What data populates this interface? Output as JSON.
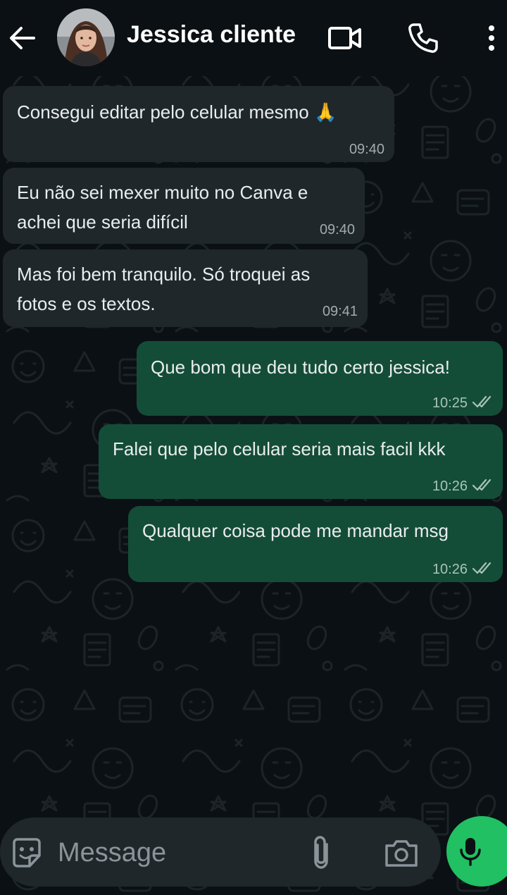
{
  "header": {
    "contact_name": "Jessica cliente",
    "back_icon": "arrow-left-icon",
    "video_icon": "video-camera-icon",
    "call_icon": "phone-icon",
    "menu_icon": "more-vertical-icon"
  },
  "messages": [
    {
      "direction": "in",
      "lines": [
        "Consegui editar pelo celular mesmo 🙏"
      ],
      "time": "09:40"
    },
    {
      "direction": "in",
      "lines": [
        "Eu não sei mexer muito no Canva e",
        "achei que seria difícil"
      ],
      "time": "09:40"
    },
    {
      "direction": "in",
      "lines": [
        "Mas foi bem tranquilo. Só troquei as",
        "fotos e os textos."
      ],
      "time": "09:41"
    },
    {
      "direction": "out",
      "lines": [
        "Que bom que deu tudo certo jessica!"
      ],
      "time": "10:25",
      "status": "read-ticks"
    },
    {
      "direction": "out",
      "lines": [
        "Falei que pelo celular seria mais facil kkk"
      ],
      "time": "10:26",
      "status": "read-ticks"
    },
    {
      "direction": "out",
      "lines": [
        "Qualquer coisa pode me mandar msg"
      ],
      "time": "10:26",
      "status": "read-ticks"
    }
  ],
  "composer": {
    "placeholder": "Message",
    "emoji_icon": "sticker-emoji-icon",
    "attach_icon": "paperclip-icon",
    "camera_icon": "camera-icon",
    "mic_icon": "microphone-icon"
  },
  "colors": {
    "background": "#0b1014",
    "incoming_bubble": "#1f272a",
    "outgoing_bubble": "#144d37",
    "accent_green": "#21c063"
  }
}
